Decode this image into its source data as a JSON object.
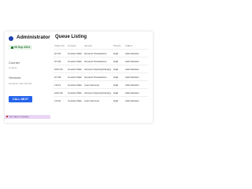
{
  "sidebar": {
    "title": "Administrator",
    "date": "06 Sep 2024",
    "counter_label": "Counter",
    "counter_value": "Counter",
    "services_label": "Services",
    "services_value": "General, Loan Service",
    "call_button": "CALL NEXT",
    "status_text": "You have no queue"
  },
  "queue": {
    "title": "Queue Listing",
    "columns": [
      "Ticket No.",
      "Counter",
      "Service",
      "Priority",
      "Called"
    ],
    "rows": [
      [
        "GT-01",
        "Counter Main",
        "General Transactions",
        "High",
        "Administrator"
      ],
      [
        "GT-02",
        "Counter Main",
        "General Transactions",
        "High",
        "Administrator"
      ],
      [
        "AOC-01",
        "Counter Main",
        "Account Opening/Closing",
        "High",
        "Administrator"
      ],
      [
        "GT-03",
        "Counter Main",
        "General Transactions",
        "High",
        "Administrator"
      ],
      [
        "LS-01",
        "Counter Main",
        "Loan Services",
        "High",
        "Administrator"
      ],
      [
        "AOC-02",
        "Counter Main",
        "Account Opening/Closing",
        "High",
        "Administrator"
      ],
      [
        "LS-02",
        "Counter Main",
        "Loan Services",
        "High",
        "Administrator"
      ]
    ]
  },
  "colors": {
    "accent": "#2563eb",
    "badge_bg": "#e8f4ea",
    "status_bg": "#e9d5f5"
  },
  "icons": [
    "user-avatar-icon",
    "calendar-icon",
    "alert-dot-icon"
  ]
}
